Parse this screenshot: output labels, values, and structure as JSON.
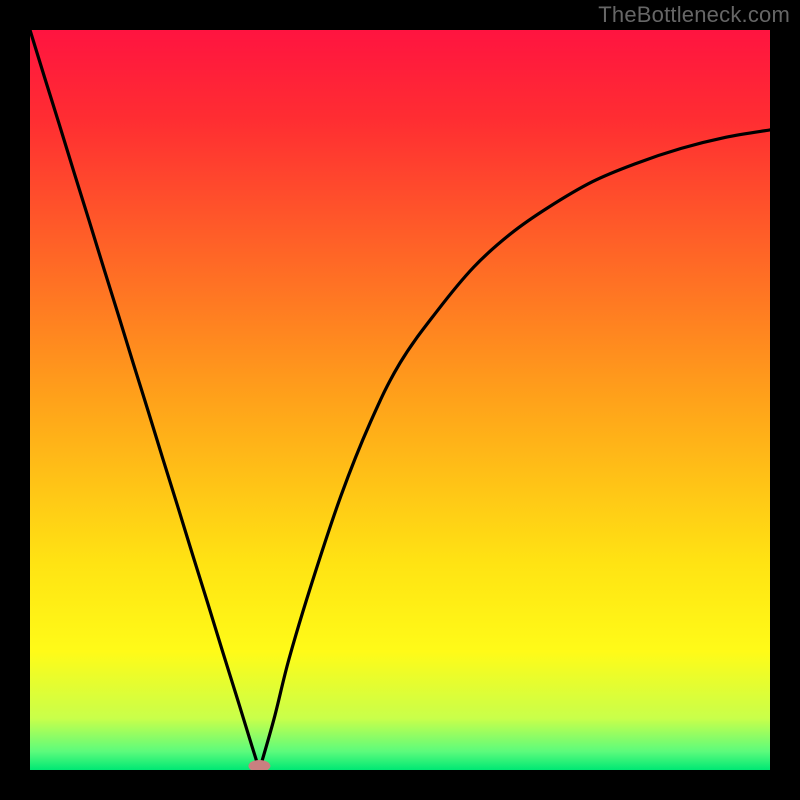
{
  "attribution": "TheBottleneck.com",
  "chart_data": {
    "type": "line",
    "title": "",
    "xlabel": "",
    "ylabel": "",
    "xlim": [
      0,
      100
    ],
    "ylim": [
      0,
      100
    ],
    "grid": false,
    "legend": false,
    "background_gradient": {
      "stops": [
        {
          "offset": 0.0,
          "color": "#ff1440"
        },
        {
          "offset": 0.12,
          "color": "#ff2d32"
        },
        {
          "offset": 0.5,
          "color": "#ffa21a"
        },
        {
          "offset": 0.72,
          "color": "#ffe313"
        },
        {
          "offset": 0.84,
          "color": "#fffb18"
        },
        {
          "offset": 0.93,
          "color": "#c9ff4a"
        },
        {
          "offset": 0.975,
          "color": "#5cfb7c"
        },
        {
          "offset": 1.0,
          "color": "#00e874"
        }
      ]
    },
    "series": [
      {
        "name": "left-branch",
        "x": [
          0,
          2,
          4,
          6,
          8,
          10,
          12,
          14,
          16,
          18,
          20,
          22,
          24,
          26,
          28,
          30,
          31
        ],
        "y": [
          100,
          93.5,
          87.1,
          80.6,
          74.2,
          67.7,
          61.3,
          54.8,
          48.4,
          41.9,
          35.5,
          29.0,
          22.6,
          16.1,
          9.7,
          3.2,
          0
        ]
      },
      {
        "name": "right-branch",
        "x": [
          31,
          33,
          35,
          38,
          42,
          46,
          50,
          55,
          60,
          65,
          70,
          76,
          82,
          88,
          94,
          100
        ],
        "y": [
          0,
          7,
          15,
          25,
          37,
          47,
          55,
          62,
          68,
          72.5,
          76,
          79.5,
          82,
          84,
          85.5,
          86.5
        ]
      }
    ],
    "min_marker": {
      "x": 31,
      "y": 0,
      "color": "#c98080"
    }
  }
}
